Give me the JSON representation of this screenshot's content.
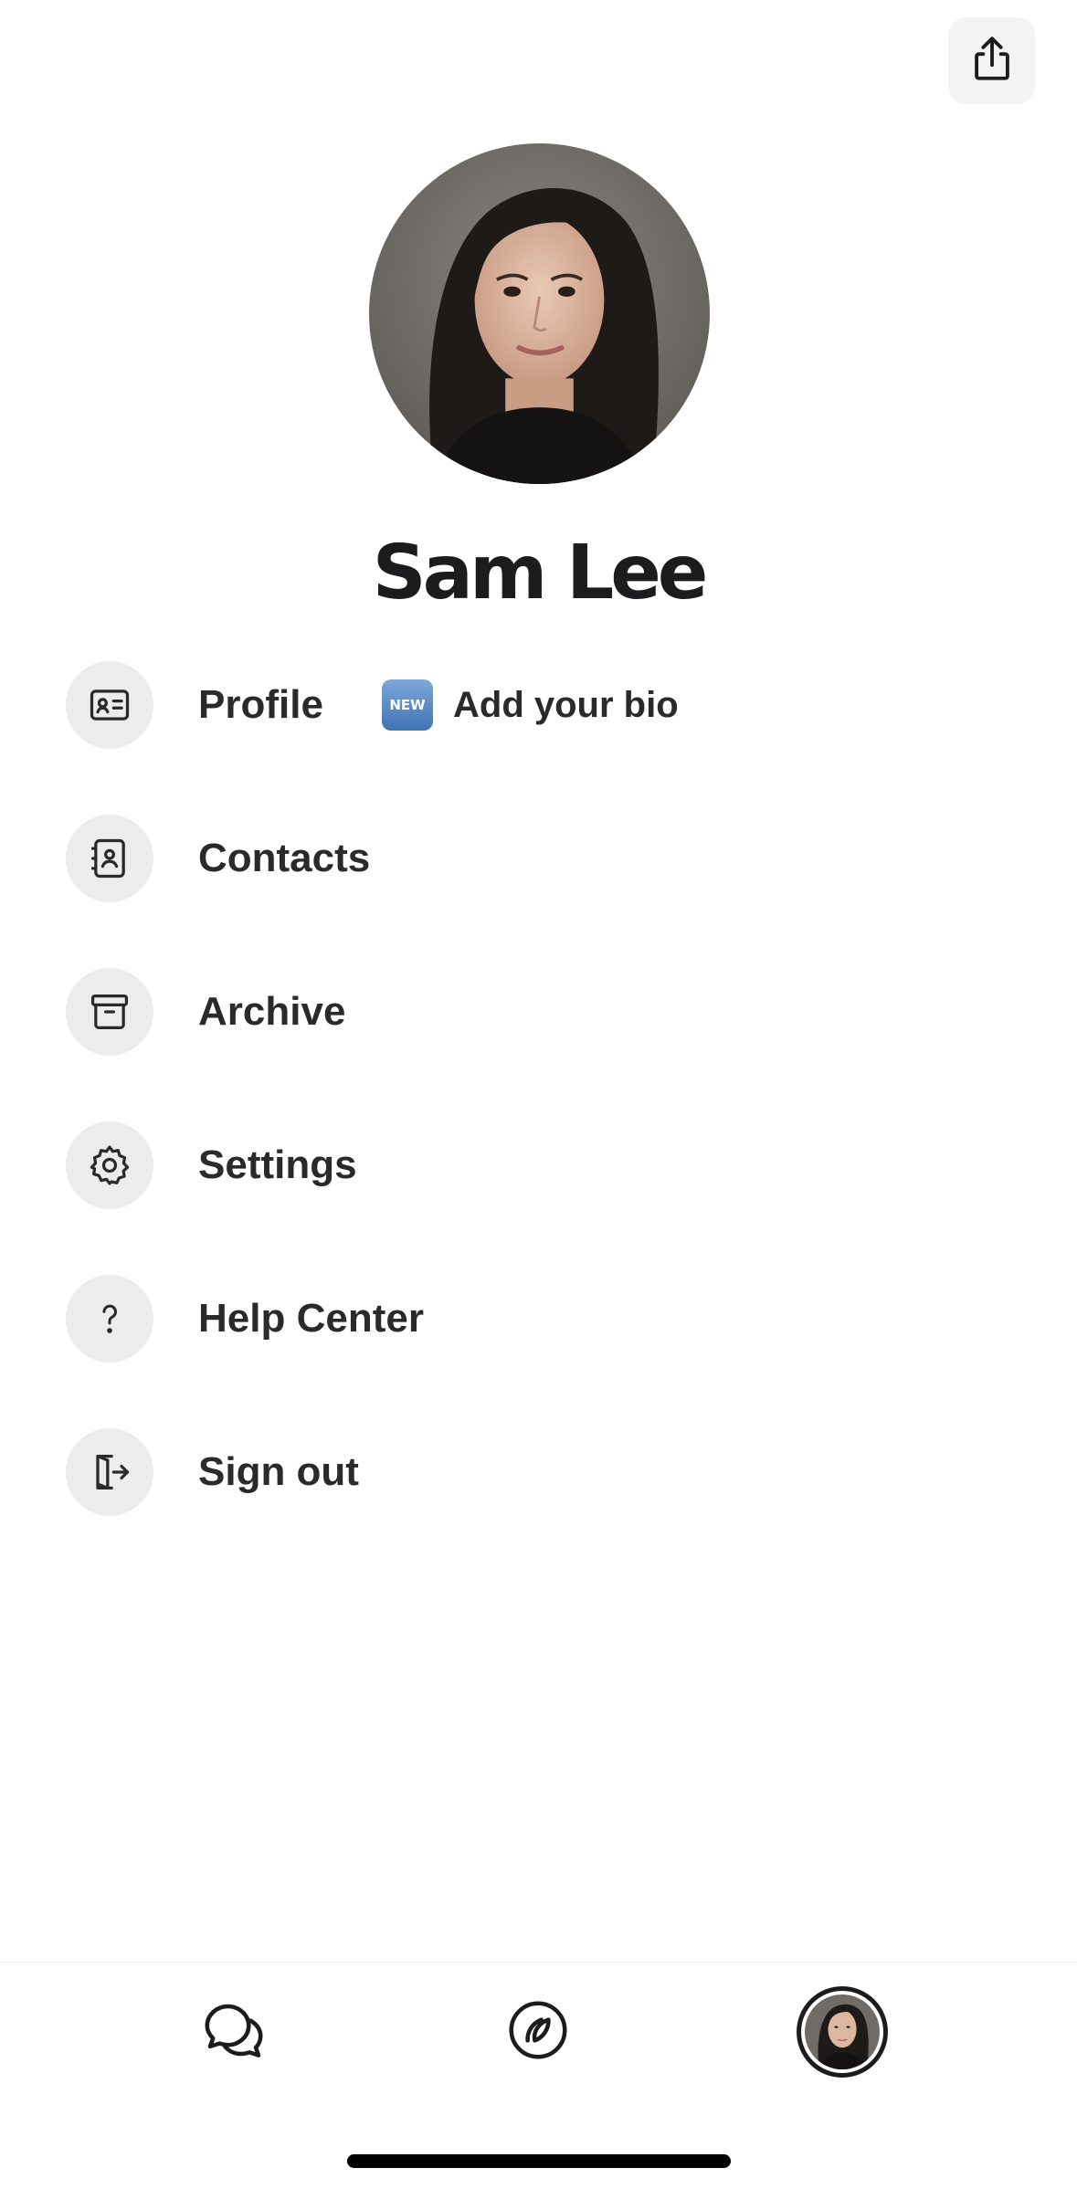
{
  "header": {
    "share_icon": "share-icon"
  },
  "profile": {
    "name": "Sam Lee"
  },
  "menu": {
    "items": [
      {
        "label": "Profile",
        "icon": "id-card-icon"
      },
      {
        "label": "Contacts",
        "icon": "contacts-book-icon"
      },
      {
        "label": "Archive",
        "icon": "archive-box-icon"
      },
      {
        "label": "Settings",
        "icon": "gear-icon"
      },
      {
        "label": "Help Center",
        "icon": "question-mark-icon"
      },
      {
        "label": "Sign out",
        "icon": "sign-out-icon"
      }
    ],
    "bio_prompt": {
      "badge": "NEW",
      "text": "Add your bio"
    }
  },
  "tab_bar": {
    "tabs": [
      {
        "name": "chats",
        "icon": "chat-bubbles-icon"
      },
      {
        "name": "discover",
        "icon": "compass-icon"
      },
      {
        "name": "profile",
        "icon": "avatar"
      }
    ]
  },
  "colors": {
    "text": "#1c1c1e",
    "icon_background": "#ececec",
    "new_badge": "#4f82c0"
  }
}
